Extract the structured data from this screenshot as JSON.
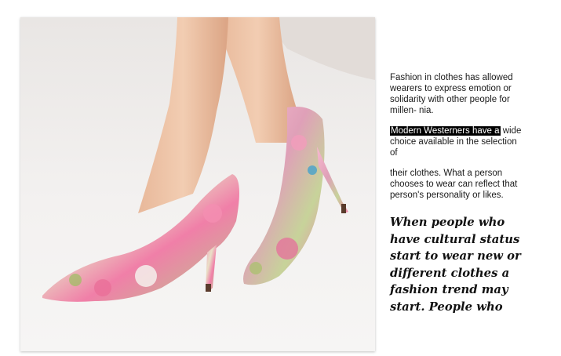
{
  "paragraphs": {
    "p1": "Fashion in clothes has allowed wearers to express emotion or solidarity with other people for millen- nia.",
    "p2_highlight": "Modern Westerners have a",
    "p2_rest": " wide choice available in the selection of",
    "p3": " their clothes. What a person chooses to wear can reflect that person's personality or likes."
  },
  "pull_quote": "When people who have cultural status start to wear new or different clothes a fashion trend may start. People who",
  "colors": {
    "background": "#ffffff",
    "photo_background": "#f1efee",
    "highlight_background": "#000000",
    "highlight_text": "#ffffff",
    "body_text": "#1a1a1a"
  }
}
